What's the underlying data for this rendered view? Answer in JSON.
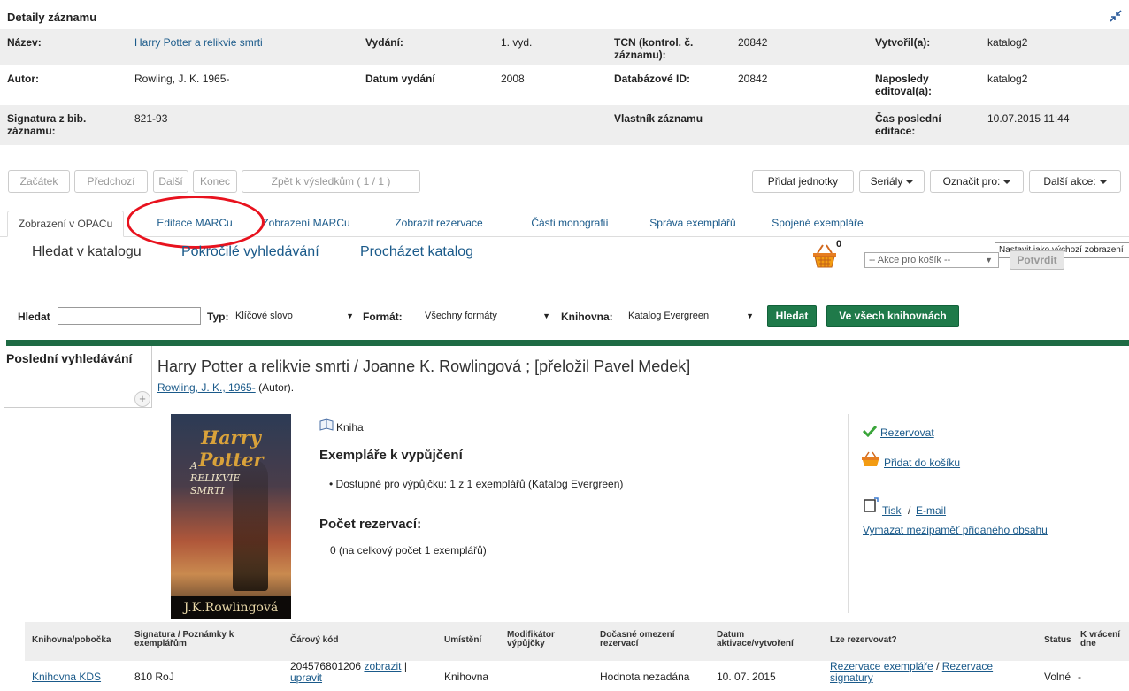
{
  "header": {
    "title": "Detaily záznamu"
  },
  "details": {
    "rows": [
      [
        {
          "label": "Název:",
          "value": "Harry Potter a relikvie smrti"
        },
        {
          "label": "Vydání:",
          "value": "1. vyd."
        },
        {
          "label": "TCN (kontrol. č. záznamu):",
          "value": "20842"
        },
        {
          "label": "Vytvořil(a):",
          "value": "katalog2"
        }
      ],
      [
        {
          "label": "Autor:",
          "value": "Rowling, J. K. 1965-"
        },
        {
          "label": "Datum vydání",
          "value": "2008"
        },
        {
          "label": "Databázové ID:",
          "value": "20842"
        },
        {
          "label": "Naposledy editoval(a):",
          "value": "katalog2"
        }
      ],
      [
        {
          "label": "Signatura z bib. záznamu:",
          "value": "821-93"
        },
        {
          "label": "",
          "value": ""
        },
        {
          "label": "Vlastník záznamu",
          "value": ""
        },
        {
          "label": "Čas poslední editace:",
          "value": "10.07.2015 11:44"
        }
      ]
    ]
  },
  "nav": {
    "start": "Začátek",
    "prev": "Předchozí",
    "next": "Další",
    "end": "Konec",
    "back": "Zpět k výsledkům ( 1 / 1 )",
    "add_units": "Přidat jednotky",
    "serials": "Seriály",
    "mark_for": "Označit pro:",
    "more_actions": "Další akce:"
  },
  "tabs": [
    "Zobrazení v OPACu",
    "Editace MARCu",
    "Zobrazení MARCu",
    "Zobrazit rezervace",
    "Části monografií",
    "Správa exemplářů",
    "Spojené exempláře"
  ],
  "tooltip": "Nastavit jako výchozí zobrazení",
  "catalog": {
    "search_label": "Hledat v katalogu",
    "advanced": "Pokročilé vyhledávání",
    "browse": "Procházet katalog",
    "cart_count": "0",
    "cart_select": "-- Akce pro košík --",
    "confirm": "Potvrdit"
  },
  "search": {
    "label": "Hledat",
    "type_label": "Typ:",
    "type_value": "Klíčové slovo",
    "format_label": "Formát:",
    "format_value": "Všechny formáty",
    "library_label": "Knihovna:",
    "library_value": "Katalog Evergreen",
    "submit": "Hledat",
    "all_libraries": "Ve všech knihovnách"
  },
  "recent": {
    "title": "Poslední vyhledávání",
    "plus": "+"
  },
  "record": {
    "title": "Harry Potter a relikvie smrti / Joanne K. Rowlingová ; [přeložil Pavel Medek]",
    "author_link": "Rowling, J. K., 1965-",
    "author_role": "(Autor).",
    "cover": {
      "series": "Harry Potter",
      "subtitle": "A RELIKVIE SMRTI",
      "author": "J.K.Rowlingová"
    },
    "format": "Kniha",
    "avail_heading": "Exempláře k vypůjčení",
    "avail_item": "Dostupné pro výpůjčku: 1 z 1 exemplářů (Katalog Evergreen)",
    "holds_heading": "Počet rezervací:",
    "holds_item": "0 (na celkový počet 1 exemplářů)"
  },
  "actions": {
    "reserve": "Rezervovat",
    "add_cart": "Přidat do košíku",
    "print": "Tisk",
    "slash": "/",
    "email": "E-mail",
    "clear_cache": "Vymazat mezipaměť přidaného obsahu"
  },
  "table": {
    "headers": [
      "Knihovna/pobočka",
      "Signatura / Poznámky k exemplářům",
      "Čárový kód",
      "Umístění",
      "Modifikátor výpůjčky",
      "Dočasné omezení rezervací",
      "Datum aktivace/vytvoření",
      "Lze rezervovat?",
      "Status",
      "K vrácení dne"
    ],
    "row": {
      "library": "Knihovna KDS",
      "call_number": "810 RoJ",
      "barcode": "204576801206",
      "show": "zobrazit",
      "sep": "|",
      "edit": "upravit",
      "location": "Knihovna",
      "modifier": "",
      "temp": "Hodnota nezadána",
      "date": "10. 07. 2015",
      "hold1": "Rezervace exempláře",
      "hold_sep": "/",
      "hold2": "Rezervace signatury",
      "status": "Volné",
      "due": "-"
    }
  },
  "colors": {
    "accent_green": "#1f7a4a",
    "link": "#1a5a8a",
    "highlight_red": "#e8121e"
  }
}
